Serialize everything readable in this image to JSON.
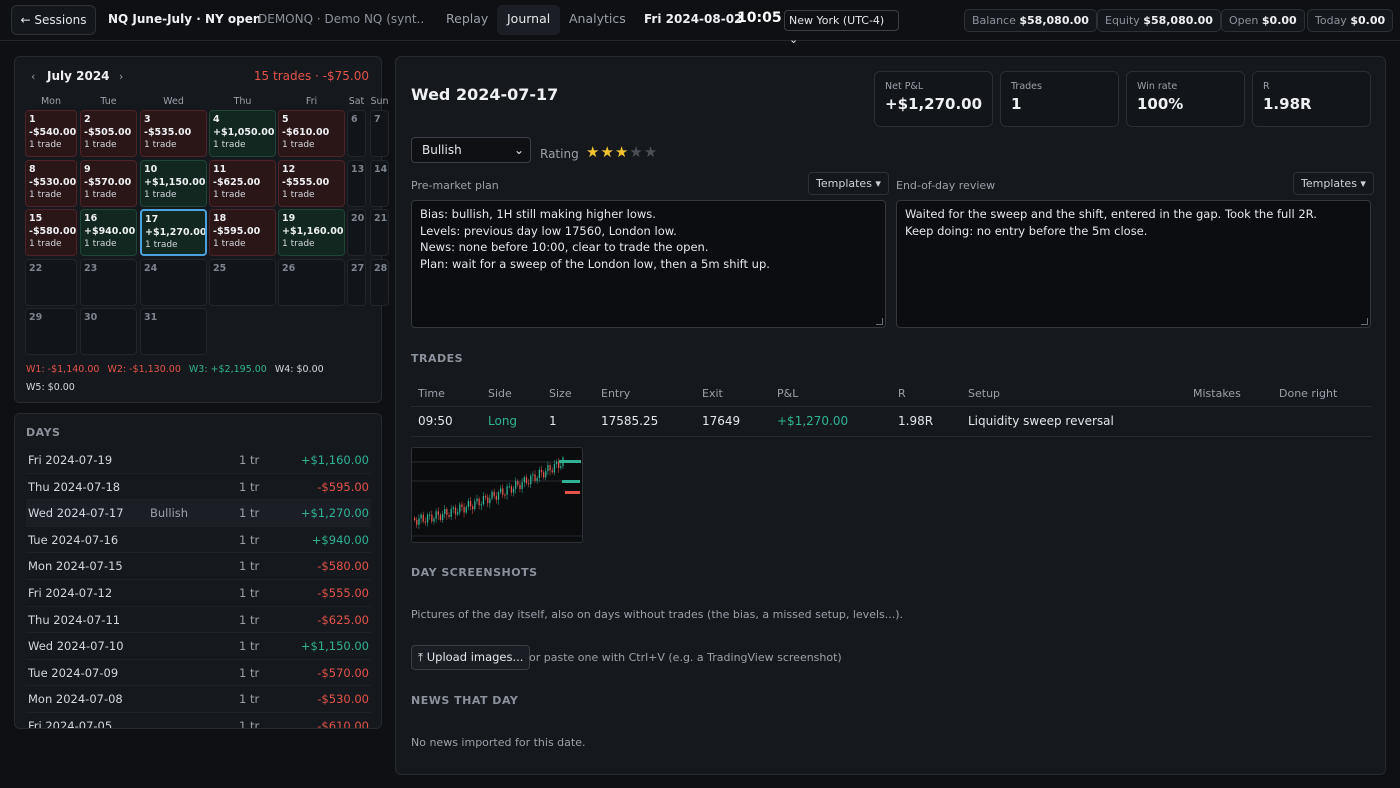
{
  "topbar": {
    "back_label": "← Sessions",
    "session_name": "NQ June-July · NY open",
    "session_sub": "DEMONQ · Demo NQ (synt...",
    "tabs": [
      {
        "label": "Replay",
        "active": false
      },
      {
        "label": "Journal",
        "active": true
      },
      {
        "label": "Analytics",
        "active": false
      }
    ],
    "clock_date": "Fri 2024-08-02",
    "clock_time": "10:05",
    "timezone": "New York (UTC-4)",
    "stats": [
      {
        "label": "Balance",
        "value": "$58,080.00"
      },
      {
        "label": "Equity",
        "value": "$58,080.00"
      },
      {
        "label": "Open",
        "value": "$0.00"
      },
      {
        "label": "Today",
        "value": "$0.00"
      }
    ]
  },
  "calendar": {
    "prev_icon": "‹",
    "next_icon": "›",
    "month": "July 2024",
    "summary": "15 trades · -$75.00",
    "dow": [
      "Mon",
      "Tue",
      "Wed",
      "Thu",
      "Fri",
      "Sat",
      "Sun"
    ],
    "weeks": [
      [
        {
          "num": "1",
          "pnl": "-$540.00",
          "trades": "1 trade",
          "kind": "loss"
        },
        {
          "num": "2",
          "pnl": "-$505.00",
          "trades": "1 trade",
          "kind": "loss"
        },
        {
          "num": "3",
          "pnl": "-$535.00",
          "trades": "1 trade",
          "kind": "loss"
        },
        {
          "num": "4",
          "pnl": "+$1,050.00",
          "trades": "1 trade",
          "kind": "win"
        },
        {
          "num": "5",
          "pnl": "-$610.00",
          "trades": "1 trade",
          "kind": "loss"
        },
        {
          "num": "6",
          "kind": "weekend"
        },
        {
          "num": "7",
          "kind": "weekend"
        }
      ],
      [
        {
          "num": "8",
          "pnl": "-$530.00",
          "trades": "1 trade",
          "kind": "loss"
        },
        {
          "num": "9",
          "pnl": "-$570.00",
          "trades": "1 trade",
          "kind": "loss"
        },
        {
          "num": "10",
          "pnl": "+$1,150.00",
          "trades": "1 trade",
          "kind": "win"
        },
        {
          "num": "11",
          "pnl": "-$625.00",
          "trades": "1 trade",
          "kind": "loss"
        },
        {
          "num": "12",
          "pnl": "-$555.00",
          "trades": "1 trade",
          "kind": "loss"
        },
        {
          "num": "13",
          "kind": "weekend"
        },
        {
          "num": "14",
          "kind": "weekend"
        }
      ],
      [
        {
          "num": "15",
          "pnl": "-$580.00",
          "trades": "1 trade",
          "kind": "loss"
        },
        {
          "num": "16",
          "pnl": "+$940.00",
          "trades": "1 trade",
          "kind": "win"
        },
        {
          "num": "17",
          "pnl": "+$1,270.00",
          "trades": "1 trade",
          "kind": "win",
          "selected": true
        },
        {
          "num": "18",
          "pnl": "-$595.00",
          "trades": "1 trade",
          "kind": "loss"
        },
        {
          "num": "19",
          "pnl": "+$1,160.00",
          "trades": "1 trade",
          "kind": "win"
        },
        {
          "num": "20",
          "kind": "weekend"
        },
        {
          "num": "21",
          "kind": "weekend"
        }
      ],
      [
        {
          "num": "22",
          "kind": "empty"
        },
        {
          "num": "23",
          "kind": "empty"
        },
        {
          "num": "24",
          "kind": "empty"
        },
        {
          "num": "25",
          "kind": "empty"
        },
        {
          "num": "26",
          "kind": "empty"
        },
        {
          "num": "27",
          "kind": "weekend"
        },
        {
          "num": "28",
          "kind": "weekend"
        }
      ],
      [
        {
          "num": "29",
          "kind": "empty"
        },
        {
          "num": "30",
          "kind": "empty"
        },
        {
          "num": "31",
          "kind": "empty"
        }
      ]
    ],
    "week_totals": [
      {
        "label": "W1: -$1,140.00",
        "kind": "neg"
      },
      {
        "label": "W2: -$1,130.00",
        "kind": "neg"
      },
      {
        "label": "W3: +$2,195.00",
        "kind": "pos"
      },
      {
        "label": "W4: $0.00",
        "kind": "neutral"
      },
      {
        "label": "W5: $0.00",
        "kind": "neutral"
      }
    ]
  },
  "days": {
    "title": "DAYS",
    "rows": [
      {
        "date": "Fri 2024-07-19",
        "bias": "",
        "trades": "1 tr",
        "pnl": "+$1,160.00",
        "kind": "pos"
      },
      {
        "date": "Thu 2024-07-18",
        "bias": "",
        "trades": "1 tr",
        "pnl": "-$595.00",
        "kind": "neg"
      },
      {
        "date": "Wed 2024-07-17",
        "bias": "Bullish",
        "trades": "1 tr",
        "pnl": "+$1,270.00",
        "kind": "pos",
        "active": true
      },
      {
        "date": "Tue 2024-07-16",
        "bias": "",
        "trades": "1 tr",
        "pnl": "+$940.00",
        "kind": "pos"
      },
      {
        "date": "Mon 2024-07-15",
        "bias": "",
        "trades": "1 tr",
        "pnl": "-$580.00",
        "kind": "neg"
      },
      {
        "date": "Fri 2024-07-12",
        "bias": "",
        "trades": "1 tr",
        "pnl": "-$555.00",
        "kind": "neg"
      },
      {
        "date": "Thu 2024-07-11",
        "bias": "",
        "trades": "1 tr",
        "pnl": "-$625.00",
        "kind": "neg"
      },
      {
        "date": "Wed 2024-07-10",
        "bias": "",
        "trades": "1 tr",
        "pnl": "+$1,150.00",
        "kind": "pos"
      },
      {
        "date": "Tue 2024-07-09",
        "bias": "",
        "trades": "1 tr",
        "pnl": "-$570.00",
        "kind": "neg"
      },
      {
        "date": "Mon 2024-07-08",
        "bias": "",
        "trades": "1 tr",
        "pnl": "-$530.00",
        "kind": "neg"
      },
      {
        "date": "Fri 2024-07-05",
        "bias": "",
        "trades": "1 tr",
        "pnl": "-$610.00",
        "kind": "neg"
      }
    ]
  },
  "journal": {
    "date": "Wed 2024-07-17",
    "kpis": [
      {
        "label": "Net P&L",
        "value": "+$1,270.00",
        "kind": "pos"
      },
      {
        "label": "Trades",
        "value": "1",
        "kind": ""
      },
      {
        "label": "Win rate",
        "value": "100%",
        "kind": ""
      },
      {
        "label": "R",
        "value": "1.98R",
        "kind": ""
      }
    ],
    "bias": "Bullish",
    "rating_label": "Rating",
    "rating": 3,
    "rating_max": 5,
    "premarket_label": "Pre-market plan",
    "eod_label": "End-of-day review",
    "templates_label": "Templates ▾",
    "premarket_lines": [
      "Bias: bullish, 1H still making higher lows.",
      "Levels: previous day low 17560, London low.",
      "News: none before 10:00, clear to trade the open.",
      "Plan: wait for a sweep of the London low, then a 5m shift up."
    ],
    "eod_lines": [
      "Waited for the sweep and the shift, entered in the gap. Took the full 2R.",
      "Keep doing: no entry before the 5m close."
    ],
    "trades_title": "TRADES",
    "trade_columns": [
      "Time",
      "Side",
      "Size",
      "Entry",
      "Exit",
      "P&L",
      "R",
      "Setup",
      "Mistakes",
      "Done right"
    ],
    "trades": [
      {
        "time": "09:50",
        "side": "Long",
        "size": "1",
        "entry": "17585.25",
        "exit": "17649",
        "pnl": "+$1,270.00",
        "r": "1.98R",
        "setup": "Liquidity sweep reversal",
        "mistakes": "",
        "done_right": ""
      }
    ],
    "shots_title": "DAY SCREENSHOTS",
    "shots_desc": "Pictures of the day itself, also on days without trades (the bias, a missed setup, levels...).",
    "upload_label": "⤒ Upload images...",
    "upload_hint": "or paste one with Ctrl+V (e.g. a TradingView screenshot)",
    "news_title": "NEWS THAT DAY",
    "news_empty": "No news imported for this date."
  },
  "colors": {
    "pos": "#2fb394",
    "neg": "#e5534b",
    "selected": "#4aa3df",
    "star": "#f2c230"
  }
}
